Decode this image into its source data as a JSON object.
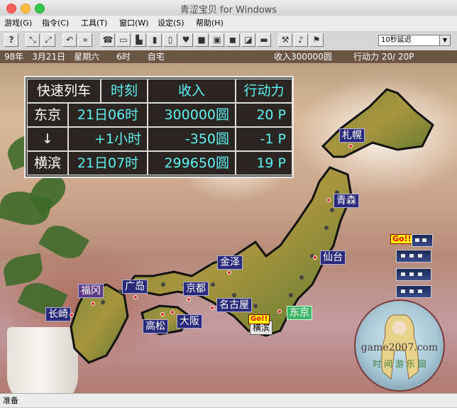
{
  "window": {
    "title": "青涩宝贝 for Windows"
  },
  "menu": [
    {
      "label": "游戏(G)"
    },
    {
      "label": "指令(C)"
    },
    {
      "label": "工具(T)"
    },
    {
      "label": "窗口(W)"
    },
    {
      "label": "设定(S)"
    },
    {
      "label": "帮助(H)"
    }
  ],
  "toolbar": {
    "help_label": "?",
    "speed_value": "10秒延迟",
    "speed_arrow": "▼"
  },
  "info": {
    "date": "98年　3月21日　星期六　　6时　　自宅",
    "income": "收入300000圆",
    "action": "行动力 20/ 20P"
  },
  "panel": {
    "headers": [
      "快速列车",
      "时刻",
      "收入",
      "行动力"
    ],
    "rows": [
      {
        "place": "东京",
        "time": "21日06时",
        "income": "300000圆",
        "action": "20 P"
      },
      {
        "place": "↓",
        "time": "+1小时",
        "income": "-350圆",
        "action": "-1 P"
      },
      {
        "place": "横滨",
        "time": "21日07时",
        "income": "299650圆",
        "action": "19 P"
      }
    ]
  },
  "stations": {
    "sapporo": "札幌",
    "aomori": "青森",
    "sendai": "仙台",
    "kanazawa": "金泽",
    "tokyo": "东京",
    "yokohama": "横滨",
    "nagoya": "名古屋",
    "kyoto": "京都",
    "osaka": "大阪",
    "takamatsu": "高松",
    "hiroshima": "广岛",
    "fukuoka": "福冈",
    "nagasaki": "长崎"
  },
  "badges": {
    "go1": "Go!!",
    "go2": "Go!!"
  },
  "watermark": {
    "site": "game2007.com",
    "tagline": "时 间 游 乐 园"
  },
  "status": {
    "text": "准备"
  }
}
